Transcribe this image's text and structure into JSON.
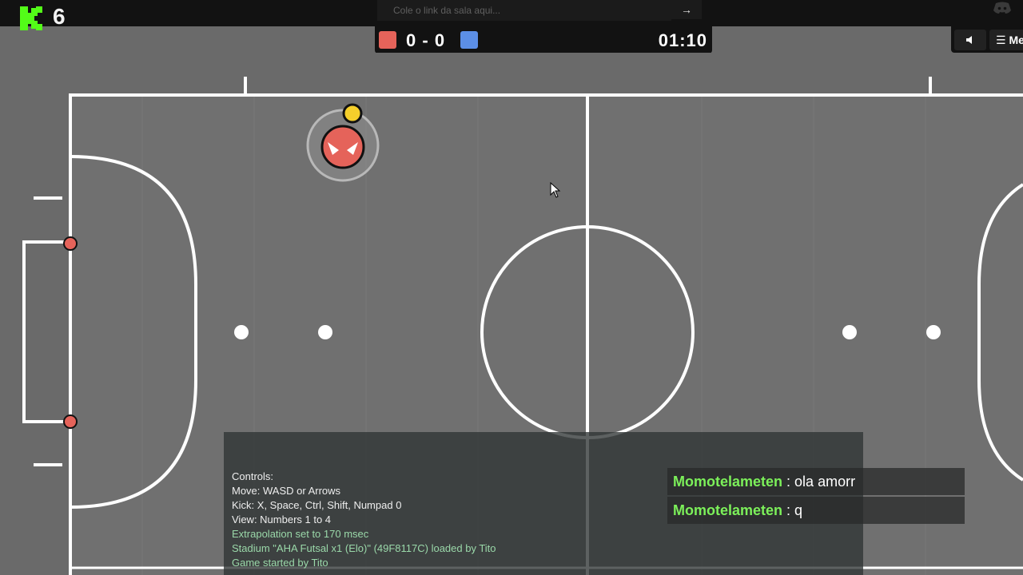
{
  "topbar": {
    "player_count": "6",
    "room_link_placeholder": "Cole o link da sala aqui...",
    "go_label": "→"
  },
  "scoreboard": {
    "red_score": "0",
    "separator": "-",
    "blue_score": "0",
    "timer": "01:10",
    "red_color": "#e5635a",
    "blue_color": "#5c8fe6"
  },
  "controls": {
    "volume_icon": "speaker-icon",
    "menu_label": "☰ Menu"
  },
  "console": {
    "lines": [
      "Controls:",
      "Move: WASD or Arrows",
      "Kick: X, Space, Ctrl, Shift, Numpad 0",
      "View: Numbers 1 to 4",
      "Extrapolation set to 170 msec",
      "Stadium \"AHA Futsal x1 (Elo)\" (49F8117C) loaded by Tito",
      "Game started by Tito"
    ]
  },
  "chat": [
    {
      "name": "Momotelameten",
      "sep": " : ",
      "text": "ola amorr"
    },
    {
      "name": "Momotelameten",
      "sep": " : ",
      "text": "q"
    }
  ]
}
